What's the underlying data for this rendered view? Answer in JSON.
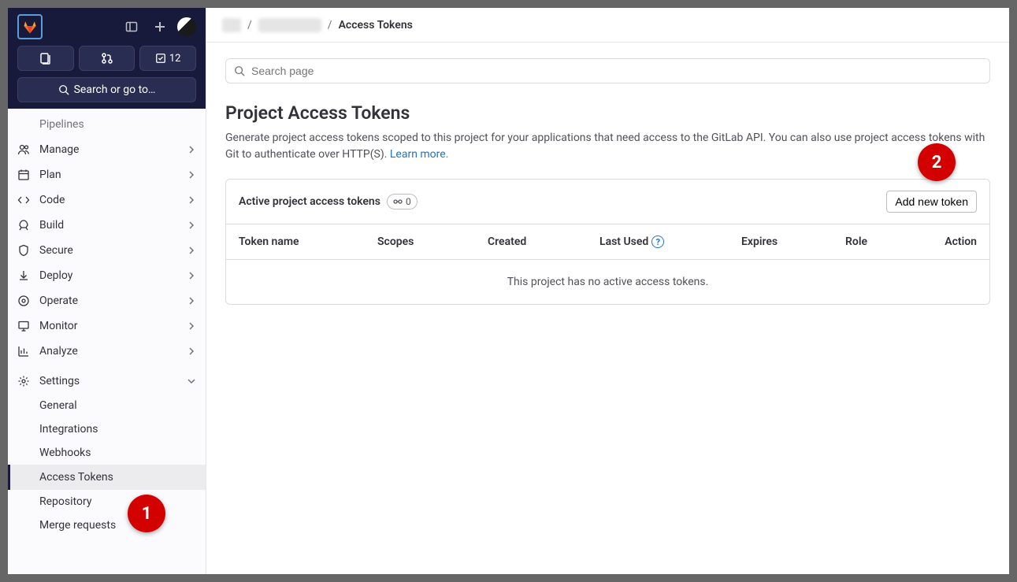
{
  "topbar": {
    "search_label": "Search or go to…",
    "todo_count": "12"
  },
  "sidebar": {
    "pipelines": "Pipelines",
    "items": [
      {
        "label": "Manage"
      },
      {
        "label": "Plan"
      },
      {
        "label": "Code"
      },
      {
        "label": "Build"
      },
      {
        "label": "Secure"
      },
      {
        "label": "Deploy"
      },
      {
        "label": "Operate"
      },
      {
        "label": "Monitor"
      },
      {
        "label": "Analyze"
      }
    ],
    "settings_label": "Settings",
    "settings": [
      {
        "label": "General"
      },
      {
        "label": "Integrations"
      },
      {
        "label": "Webhooks"
      },
      {
        "label": "Access Tokens"
      },
      {
        "label": "Repository"
      },
      {
        "label": "Merge requests"
      }
    ]
  },
  "breadcrumb": {
    "current": "Access Tokens"
  },
  "page": {
    "search_placeholder": "Search page",
    "title": "Project Access Tokens",
    "desc_prefix": "Generate project access tokens scoped to this project for your applications that need access to the GitLab API. You can also use project access tokens with Git to authenticate over HTTP(S). ",
    "learn_more": "Learn more."
  },
  "card": {
    "title": "Active project access tokens",
    "count": "0",
    "add_btn": "Add new token",
    "columns": {
      "name": "Token name",
      "scopes": "Scopes",
      "created": "Created",
      "last_used": "Last Used",
      "expires": "Expires",
      "role": "Role",
      "action": "Action"
    },
    "empty": "This project has no active access tokens."
  },
  "callouts": {
    "one": "1",
    "two": "2"
  }
}
